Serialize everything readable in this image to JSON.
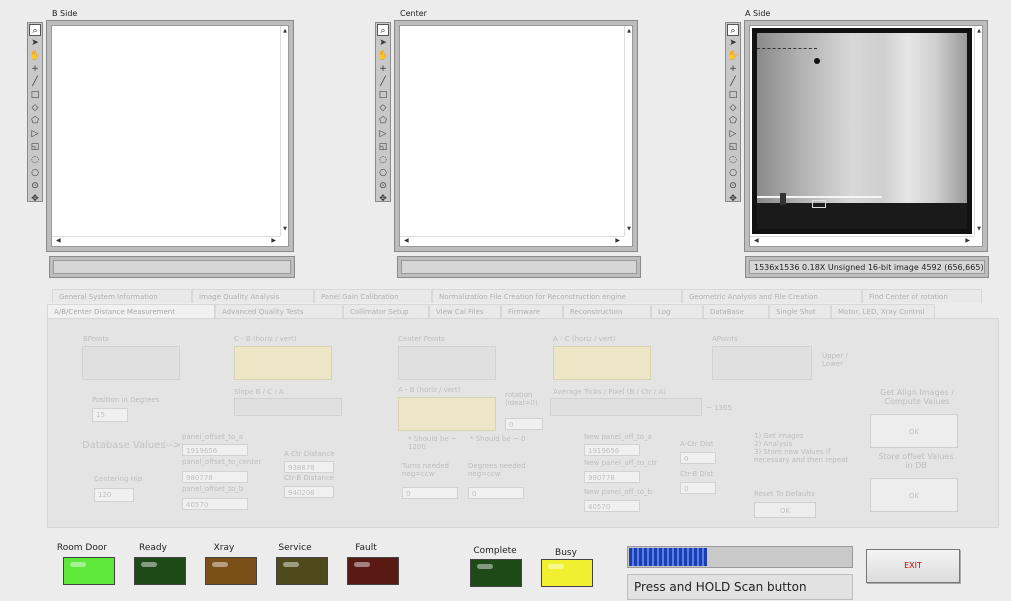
{
  "panels": {
    "b_side": {
      "title": "B Side",
      "status": ""
    },
    "center": {
      "title": "Center",
      "status": ""
    },
    "a_side": {
      "title": "A Side",
      "status": "1536x1536 0.18X Unsigned 16-bit image 4592   (656,665)"
    }
  },
  "tools": [
    "zoom-icon",
    "arrow-icon",
    "hand-icon",
    "crosshair-icon",
    "line-icon",
    "rectangle-icon",
    "diamond-icon",
    "polygon-icon",
    "freehand-icon",
    "rotated-rect-icon",
    "annulus-icon",
    "oval-icon",
    "multi-point-icon",
    "pan-icon"
  ],
  "tabs": {
    "row1": [
      "General System Information",
      "Image Quality Analysis",
      "Panel Gain Calibration",
      "Normalization File Creation for Reconstruction engine",
      "Geometric Analysis and File Creation",
      "Find Center of rotation"
    ],
    "row2": [
      "A/B/Center Distance Measurement",
      "Advanced Quality Tests",
      "Collimator Setup",
      "View Cal Files",
      "Firmware",
      "Reconstruction",
      "Log",
      "DataBase",
      "Single Shot",
      "Motor, LED, Xray Control"
    ]
  },
  "measurement": {
    "bpoints_label": "BPoints",
    "cb_label": "C - B (horiz / vert)",
    "center_points_label": "Center Points",
    "ac_label": "A - C (horiz / vert)",
    "apoints_label": "APoints",
    "upper_lower_label": "Upper / Lower",
    "slope_label": "Slope B / C / A",
    "ab_label": "A - B (horiz / vert)",
    "rotation_label": "rotation (ideal=0)",
    "rotation_value": "0",
    "avg_ticks_label": "Average Ticks / Pixel (B / Ctr / A)",
    "avg_ticks_suffix": "~ 1365",
    "position_label": "Position in Degrees",
    "position_value": "15",
    "db_values_label": "Database Values-->",
    "panel_offset_to_a_label": "panel_offset_to_a",
    "panel_offset_to_a_value": "1919656",
    "panel_offset_to_center_label": "panel_offset_to_center",
    "panel_offset_to_center_value": "980778",
    "panel_offset_to_b_label": "panel_offset_to_b",
    "panel_offset_to_b_value": "40570",
    "centering_hip_label": "Centering Hip",
    "centering_hip_value": "120",
    "a_ctr_distance_label": "A-Ctr Distance",
    "a_ctr_distance_value": "938878",
    "ctr_b_distance_label": "Ctr-B Distance",
    "ctr_b_distance_value": "940208",
    "should_be_1200": "* Should be ~ 1200",
    "should_be_0": "* Should be ~ 0",
    "turns_needed_label": "Turns needed neg=ccw",
    "turns_needed_value": "0",
    "degrees_needed_label": "Degrees needed neg=ccw",
    "degrees_needed_value": "0",
    "new_offset_a_label": "New panel_off_to_a",
    "new_offset_a_value": "1919656",
    "new_offset_ctr_label": "New panel_off_to_ctr",
    "new_offset_ctr_value": "980778",
    "new_offset_b_label": "New panel_off_to_b",
    "new_offset_b_value": "40570",
    "a_ctr_dist_label": "A-Ctr Dist",
    "a_ctr_dist_value": "0",
    "ctr_b_dist_label": "Ctr-B Dist",
    "ctr_b_dist_value": "0",
    "instructions": [
      "1) Get images",
      "2) Analysis",
      "3) Store new Values if",
      "necessary and then repeat"
    ],
    "reset_label": "Reset To Defaults",
    "reset_ok": "OK",
    "get_align_label": "Get Align Images / Compute Values",
    "get_align_ok": "OK",
    "store_offset_label": "Store offset Values in DB",
    "store_offset_ok": "OK"
  },
  "indicators": [
    {
      "label": "Room Door",
      "color": "#5ee83a"
    },
    {
      "label": "Ready",
      "color": "#1e4a18"
    },
    {
      "label": "Xray",
      "color": "#7a5018"
    },
    {
      "label": "Service",
      "color": "#4e4a1c"
    },
    {
      "label": "Fault",
      "color": "#5a1a14"
    },
    {
      "label": "Complete",
      "color": "#1e4a18"
    },
    {
      "label": "Busy",
      "color": "#f0f030"
    }
  ],
  "progress": {
    "fraction": 0.35
  },
  "scan_message": "Press and HOLD Scan button",
  "exit_label": "EXIT"
}
